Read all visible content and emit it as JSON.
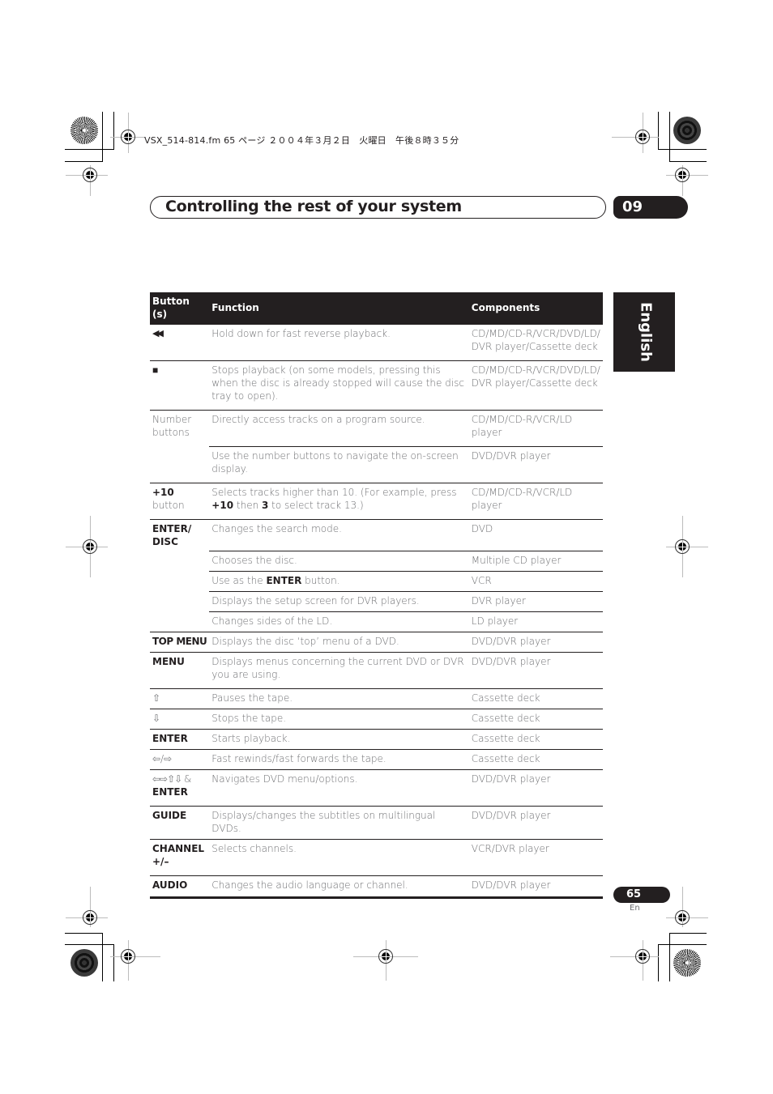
{
  "file_info": "VSX_514-814.fm  65 ページ  ２００４年３月２日　火曜日　午後８時３５分",
  "header": {
    "title": "Controlling the rest of your system",
    "chapter": "09"
  },
  "side_tab": {
    "language": "English"
  },
  "table": {
    "columns": [
      "Button (s)",
      "Function",
      "Components"
    ],
    "rows": [
      {
        "button": "◀◀",
        "function": "Hold down for fast reverse playback.",
        "components": "CD/MD/CD-R/VCR/DVD/LD/ DVR player/Cassette deck"
      },
      {
        "button": "■",
        "function": "Stops playback (on some models, pressing this when the disc is already stopped will cause the disc tray to open).",
        "components": "CD/MD/CD-R/VCR/DVD/LD/ DVR player/Cassette deck"
      },
      {
        "button": "Number buttons",
        "function": "Directly access tracks on a program source.",
        "components": "CD/MD/CD-R/VCR/LD player"
      },
      {
        "button": "",
        "function": "Use the number buttons to navigate the on-screen display.",
        "components": "DVD/DVR player"
      },
      {
        "button_bold": "+10",
        "button_rest": " button",
        "function_parts": [
          "Selects tracks higher than 10. (For example, press ",
          "+10",
          " then ",
          "3",
          " to select track 13.)"
        ],
        "components": "CD/MD/CD-R/VCR/LD player"
      },
      {
        "button": "ENTER/ DISC",
        "function": "Changes the search mode.",
        "components": "DVD"
      },
      {
        "button": "",
        "function": "Chooses the disc.",
        "components": "Multiple CD player"
      },
      {
        "button": "",
        "function_parts": [
          "Use as the ",
          "ENTER",
          " button."
        ],
        "components": "VCR"
      },
      {
        "button": "",
        "function": "Displays the setup screen for DVR players.",
        "components": "DVR player"
      },
      {
        "button": "",
        "function": "Changes sides of the LD.",
        "components": "LD player"
      },
      {
        "button": "TOP MENU",
        "function": "Displays the disc ‘top’ menu of a DVD.",
        "components": "DVD/DVR player"
      },
      {
        "button": "MENU",
        "function": "Displays menus concerning the current DVD or DVR you are using.",
        "components": "DVD/DVR player"
      },
      {
        "button": "⇧",
        "function": "Pauses the tape.",
        "components": "Cassette deck"
      },
      {
        "button": "⇩",
        "function": "Stops the tape.",
        "components": "Cassette deck"
      },
      {
        "button": "ENTER",
        "function": "Starts playback.",
        "components": "Cassette deck"
      },
      {
        "button": "⇦/⇨",
        "function": "Fast rewinds/fast forwards the tape.",
        "components": "Cassette deck"
      },
      {
        "button_arrows": "⇦⇨⇧⇩ &",
        "button_bold": "ENTER",
        "function": "Navigates DVD menu/options.",
        "components": "DVD/DVR player"
      },
      {
        "button": "GUIDE",
        "function": "Displays/changes the subtitles on multilingual DVDs.",
        "components": "DVD/DVR player"
      },
      {
        "button": "CHANNEL +/–",
        "function": "Selects channels.",
        "components": "VCR/DVR player"
      },
      {
        "button": "AUDIO",
        "function": "Changes the audio language or channel.",
        "components": "DVD/DVR player"
      }
    ]
  },
  "footer": {
    "page_number": "65",
    "page_lang": "En"
  }
}
